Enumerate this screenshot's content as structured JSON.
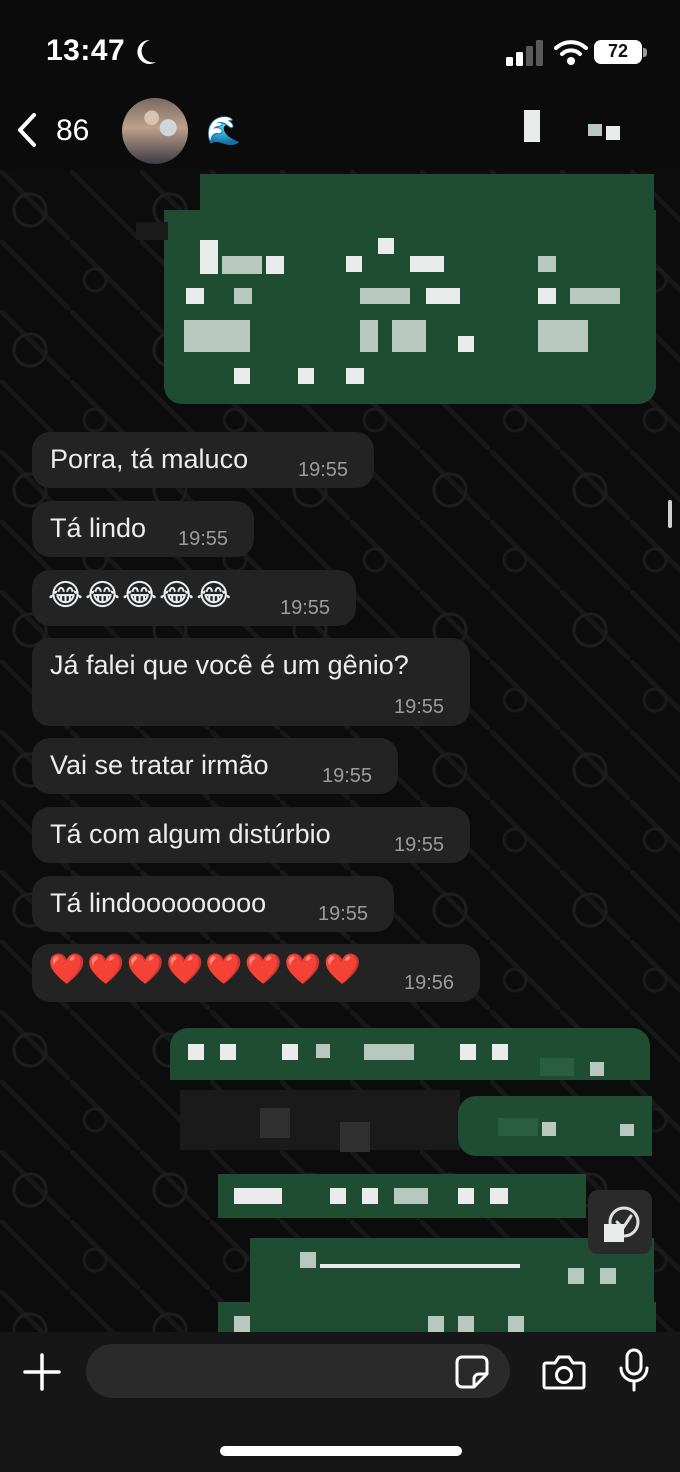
{
  "status_bar": {
    "time": "13:47",
    "battery": "72",
    "icons": [
      "moon-icon",
      "signal-icon",
      "wifi-icon",
      "battery-icon"
    ]
  },
  "header": {
    "unread_count": "86",
    "contact_emoji": "🌊",
    "icons": [
      "chevron-left-icon",
      "avatar"
    ]
  },
  "messages": [
    {
      "text": "Porra, tá maluco",
      "time": "19:55"
    },
    {
      "text": "Tá lindo",
      "time": "19:55"
    },
    {
      "text": "😂😂😂😂😂",
      "time": "19:55"
    },
    {
      "text": "Já falei que você é um gênio?",
      "time": "19:55"
    },
    {
      "text": "Vai se tratar irmão",
      "time": "19:55"
    },
    {
      "text": "Tá com algum distúrbio",
      "time": "19:55"
    },
    {
      "text": "Tá lindooooooooo",
      "time": "19:55"
    },
    {
      "text": "❤️❤️❤️❤️❤️❤️❤️❤️",
      "time": "19:56"
    }
  ],
  "input_bar": {
    "icons": [
      "plus-icon",
      "sticker-icon",
      "camera-icon",
      "mic-icon"
    ]
  },
  "colors": {
    "incoming_bubble": "#232323",
    "outgoing_bubble": "#1e4d33",
    "background": "#0b0b0b",
    "timestamp": "#9c9c9c"
  }
}
